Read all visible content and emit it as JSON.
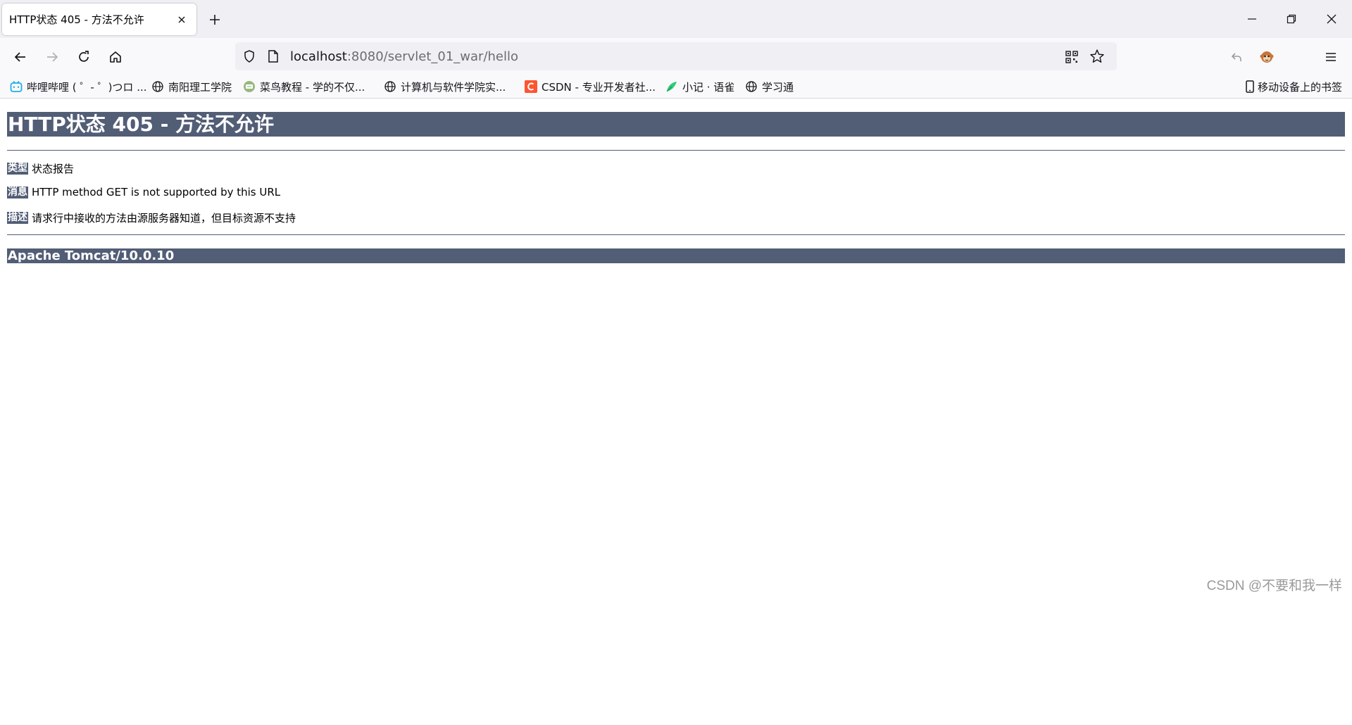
{
  "tab": {
    "title": "HTTP状态 405 - 方法不允许"
  },
  "address_bar": {
    "host": "localhost",
    "rest": ":8080/servlet_01_war/hello"
  },
  "bookmarks": [
    {
      "label": "哔哩哔哩 ( ゜- ゜)つロ ...",
      "icon": "bilibili-icon"
    },
    {
      "label": "南阳理工学院",
      "icon": "globe-icon"
    },
    {
      "label": "菜鸟教程 - 学的不仅...",
      "icon": "runoob-icon"
    },
    {
      "label": "计算机与软件学院实...",
      "icon": "globe-icon"
    },
    {
      "label": "CSDN - 专业开发者社...",
      "icon": "csdn-icon"
    },
    {
      "label": "小记 · 语雀",
      "icon": "yuque-icon"
    },
    {
      "label": "学习通",
      "icon": "globe-icon"
    }
  ],
  "mobile_bookmarks": "移动设备上的书签",
  "page": {
    "title": "HTTP状态 405 - 方法不允许",
    "type_label": "类型",
    "type_value": "状态报告",
    "message_label": "消息",
    "message_value": "HTTP method GET is not supported by this URL",
    "description_label": "描述",
    "description_value": "请求行中接收的方法由源服务器知道，但目标资源不支持",
    "server": "Apache Tomcat/10.0.10"
  },
  "watermark": "CSDN @不要和我一样",
  "colors": {
    "tomcat_header": "#525d76",
    "tab_bar": "#f0f0f4",
    "toolbar": "#f9f9fb"
  }
}
